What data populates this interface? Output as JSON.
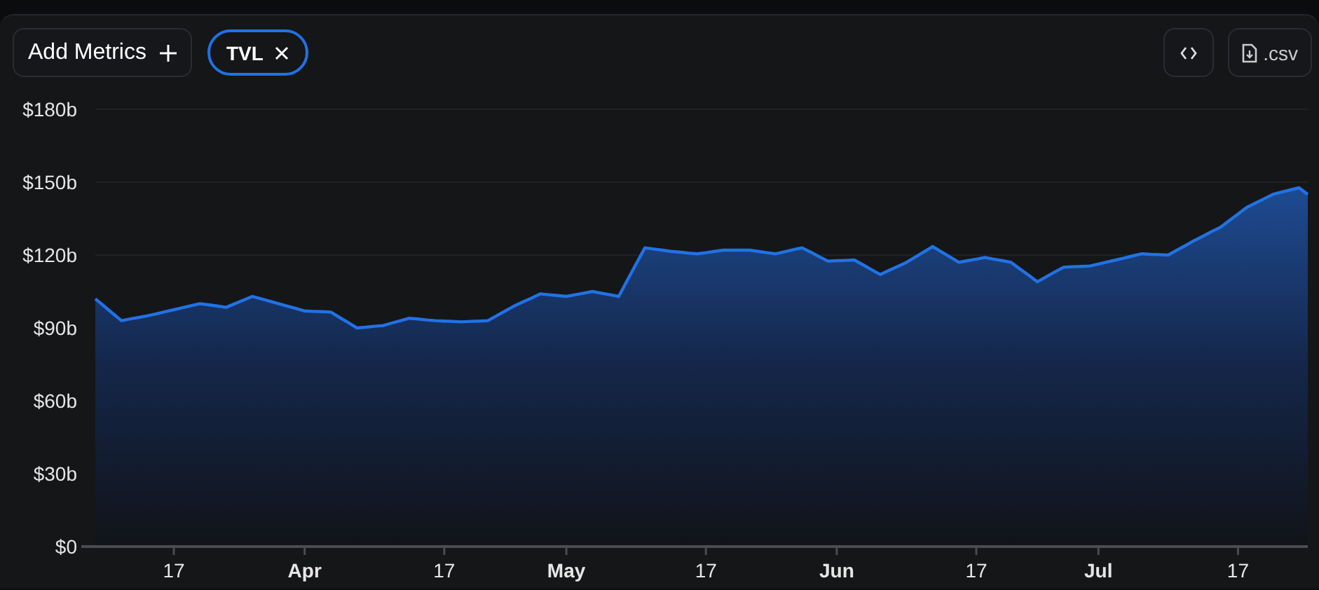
{
  "toolbar": {
    "add_button": {
      "label": "Add Metrics"
    },
    "csv_button": {
      "label": ".csv"
    }
  },
  "chart": {
    "chart_data": {
      "type": "area",
      "ylim": [
        0,
        180
      ],
      "categories": [
        null,
        null,
        null,
        null,
        null,
        null,
        null,
        null,
        null,
        "17",
        null,
        null,
        null,
        null,
        null,
        null,
        null,
        null,
        null,
        null,
        null,
        null,
        null,
        null,
        "Apr",
        null,
        null,
        null,
        null,
        null,
        null,
        null,
        null,
        null,
        null,
        null,
        null,
        null,
        null,
        null,
        "17",
        null,
        null,
        null,
        null,
        null,
        null,
        null,
        null,
        null,
        null,
        null,
        null,
        null,
        "May",
        null,
        null,
        null,
        null,
        null,
        null,
        null,
        null,
        null,
        null,
        null,
        null,
        null,
        null,
        null,
        "17",
        null,
        null,
        null,
        null,
        null,
        null,
        null,
        null,
        null,
        null,
        null,
        null,
        null,
        null,
        "Jun",
        null,
        null,
        null,
        null,
        null,
        null,
        null,
        null,
        null,
        null,
        null,
        null,
        null,
        null,
        null,
        "17",
        null,
        null,
        null,
        null,
        null,
        null,
        null,
        null,
        null,
        null,
        null,
        null,
        null,
        "Jul",
        null,
        null,
        null,
        null,
        null,
        null,
        null,
        null,
        null,
        null,
        null,
        null,
        null,
        null,
        null,
        "17",
        null,
        null,
        null,
        null,
        null,
        null,
        null,
        null
      ],
      "series": [
        {
          "name": "TVL",
          "color": "#2172e5",
          "values": [
            102,
            99,
            96,
            93,
            93.7,
            94.3,
            95,
            95.8,
            96.7,
            97.5,
            98.3,
            99.2,
            100,
            99.5,
            99,
            98.5,
            100,
            101.5,
            103,
            102,
            101,
            100,
            99,
            98,
            97,
            96.8,
            96.7,
            96.5,
            94.3,
            92.2,
            90,
            90.3,
            90.7,
            91,
            92,
            93,
            94,
            93.7,
            93.3,
            93,
            92.8,
            92.7,
            92.5,
            92.7,
            92.8,
            93,
            95,
            97,
            99,
            100.7,
            102.3,
            104,
            103.7,
            103.3,
            103,
            103.7,
            104.3,
            105,
            104.3,
            103.7,
            103,
            109.7,
            116.3,
            123,
            122.5,
            122,
            121.5,
            121.2,
            120.8,
            120.5,
            121,
            121.5,
            122,
            122,
            122,
            122,
            121.5,
            121,
            120.5,
            121.3,
            122.2,
            123,
            121.2,
            119.3,
            117.5,
            117.7,
            117.8,
            118,
            116,
            114,
            112,
            113.7,
            115.3,
            117,
            119.2,
            121.3,
            123.5,
            121.3,
            119.2,
            117,
            117.7,
            118.3,
            119,
            118.3,
            117.7,
            117,
            114.3,
            111.7,
            109,
            111,
            113,
            115,
            115.2,
            115.3,
            115.5,
            116.3,
            117.2,
            118,
            118.8,
            119.7,
            120.5,
            120.3,
            120.2,
            120,
            122,
            124,
            126,
            127.8,
            129.7,
            131.5,
            134.2,
            136.9,
            139.6,
            141.4,
            143.2,
            145,
            145.9,
            146.8,
            147.7,
            145
          ]
        }
      ],
      "yticks": [
        {
          "value": 0,
          "label": "$0"
        },
        {
          "value": 30,
          "label": "$30b"
        },
        {
          "value": 60,
          "label": "$60b"
        },
        {
          "value": 90,
          "label": "$90b"
        },
        {
          "value": 120,
          "label": "$120b"
        },
        {
          "value": 150,
          "label": "$150b"
        },
        {
          "value": 180,
          "label": "$180b"
        }
      ]
    }
  }
}
